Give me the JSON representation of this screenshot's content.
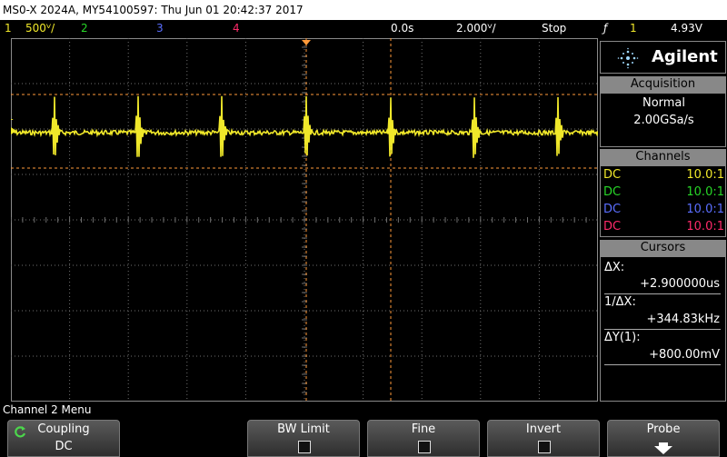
{
  "title_bar": "MS0-X 2024A, MY54100597: Thu Jun 01 20:42:37 2017",
  "status": {
    "ch1_num": "1",
    "ch1_scale": "500ⱽ/",
    "ch2_num": "2",
    "ch3_num": "3",
    "ch4_num": "4",
    "time_offset": "0.0s",
    "time_scale": "2.000ⱽ/",
    "run_state": "Stop",
    "trigger_icon": "ƒ",
    "trig_ch": "1",
    "trig_level": "4.93V"
  },
  "colors": {
    "ch1": "#f0e82a",
    "ch2": "#27d627",
    "ch3": "#5a6eff",
    "ch4": "#ff2a6a",
    "cursor": "#ff9a3a",
    "grid": "#6f6f6f",
    "panel_head": "#888888"
  },
  "side_panel": {
    "brand": "Agilent",
    "acquisition": {
      "header": "Acquisition",
      "mode": "Normal",
      "rate": "2.00GSa/s"
    },
    "channels": {
      "header": "Channels",
      "rows": [
        {
          "coupling": "DC",
          "ratio": "10.0:1"
        },
        {
          "coupling": "DC",
          "ratio": "10.0:1"
        },
        {
          "coupling": "DC",
          "ratio": "10.0:1"
        },
        {
          "coupling": "DC",
          "ratio": "10.0:1"
        }
      ]
    },
    "cursors": {
      "header": "Cursors",
      "dx_label": "ΔX:",
      "dx_value": "+2.900000us",
      "inv_dx_label": "1/ΔX:",
      "inv_dx_value": "+344.83kHz",
      "dy_label": "ΔY(1):",
      "dy_value": "+800.00mV"
    }
  },
  "screen": {
    "trigger_marker": "T",
    "ch1_ground_marker": "1"
  },
  "menu_label": "Channel 2 Menu",
  "softkeys": {
    "coupling": {
      "label": "Coupling",
      "value": "DC"
    },
    "bw_limit": {
      "label": "BW Limit"
    },
    "fine": {
      "label": "Fine"
    },
    "invert": {
      "label": "Invert"
    },
    "probe": {
      "label": "Probe"
    }
  }
}
